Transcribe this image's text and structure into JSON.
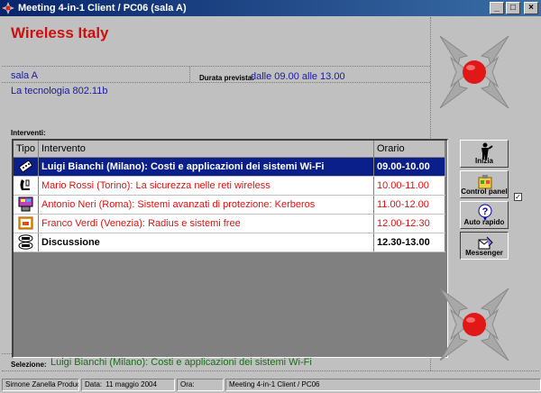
{
  "window": {
    "title": "Meeting 4-in-1 Client / PC06 (sala A)"
  },
  "meeting": {
    "title": "Wireless Italy",
    "room": "sala A",
    "duration_label": "Durata prevista:",
    "duration_value": "dalle 09.00 alle 13.00",
    "subject": "La tecnologia 802.11b"
  },
  "interventi": {
    "label": "Interventi:",
    "columns": {
      "tipo": "Tipo",
      "intervento": "Intervento",
      "orario": "Orario"
    },
    "rows": [
      {
        "icon": "remote-control-icon",
        "title": "Luigi Bianchi (Milano): Costi e applicazioni dei sistemi Wi-Fi",
        "time": "09.00-10.00",
        "state": "selected"
      },
      {
        "icon": "phone-icon",
        "title": "Mario Rossi (Torino): La sicurezza nelle reti wireless",
        "time": "10.00-11.00",
        "state": "pending"
      },
      {
        "icon": "projector-icon",
        "title": "Antonio Neri (Roma): Sistemi avanzati di protezione: Kerberos",
        "time": "11.00-12.00",
        "state": "pending"
      },
      {
        "icon": "presentation-icon",
        "title": "Franco Verdi (Venezia): Radius e sistemi free",
        "time": "12.00-12.30",
        "state": "pending"
      },
      {
        "icon": "def-abc-icon",
        "title": "Discussione",
        "time": "12.30-13.00",
        "state": "discussion"
      }
    ]
  },
  "selection": {
    "label": "Selezione:",
    "value": "Luigi Bianchi (Milano): Costi e applicazioni dei sistemi Wi-Fi"
  },
  "side_buttons": {
    "inizia": "Inizia",
    "control_panel": "Control panel",
    "auto_rapido": "Auto rapido",
    "messenger": "Messenger"
  },
  "status": {
    "author": "Simone Zanella Productions",
    "date_label": "Data:",
    "date_value": "11 maggio 2004",
    "time_label": "Ora:",
    "time_value": "",
    "client": "Meeting 4-in-1 Client / PC06"
  },
  "colors": {
    "title_red": "#cc1010",
    "info_blue": "#1a1aa0",
    "selected_row": "#0a1f8a",
    "pending_red": "#e01010",
    "selection_green": "#1a6b1a"
  }
}
